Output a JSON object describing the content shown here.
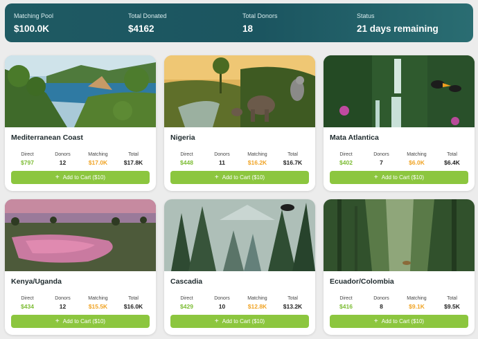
{
  "stats": [
    {
      "label": "Matching Pool",
      "value": "$100.0K"
    },
    {
      "label": "Total Donated",
      "value": "$4162"
    },
    {
      "label": "Total Donors",
      "value": "18"
    },
    {
      "label": "Status",
      "value": "21 days remaining"
    }
  ],
  "metric_labels": {
    "direct": "Direct",
    "donors": "Donors",
    "matching": "Matching",
    "total": "Total"
  },
  "button_label": "Add to Cart ($10)",
  "colors": {
    "direct": "#7cbc33",
    "matching": "#f0a323",
    "button": "#8cc63f",
    "banner": "#1f5a63"
  },
  "projects": [
    {
      "name": "Mediterranean Coast",
      "direct": "$797",
      "donors": "12",
      "matching": "$17.0K",
      "total": "$17.8K"
    },
    {
      "name": "Nigeria",
      "direct": "$448",
      "donors": "11",
      "matching": "$16.2K",
      "total": "$16.7K"
    },
    {
      "name": "Mata Atlantica",
      "direct": "$402",
      "donors": "7",
      "matching": "$6.0K",
      "total": "$6.4K"
    },
    {
      "name": "Kenya/Uganda",
      "direct": "$434",
      "donors": "12",
      "matching": "$15.5K",
      "total": "$16.0K"
    },
    {
      "name": "Cascadia",
      "direct": "$429",
      "donors": "10",
      "matching": "$12.8K",
      "total": "$13.2K"
    },
    {
      "name": "Ecuador/Colombia",
      "direct": "$416",
      "donors": "8",
      "matching": "$9.1K",
      "total": "$9.5K"
    }
  ]
}
